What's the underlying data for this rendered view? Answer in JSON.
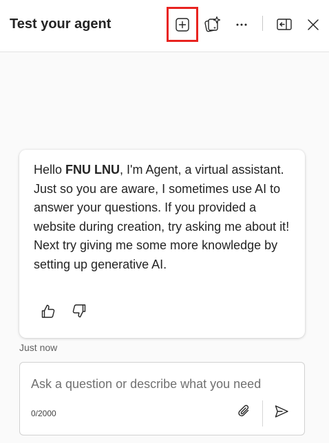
{
  "header": {
    "title": "Test your agent",
    "icons": {
      "new_chat": "add-square-icon",
      "copilot": "sparkle-copy-icon",
      "more": "more-horizontal-icon",
      "dock": "panel-left-icon",
      "close": "close-icon"
    },
    "highlight_color": "#e8231f"
  },
  "message": {
    "greeting": "Hello ",
    "user_name": "FNU LNU",
    "body": ", I'm Agent, a virtual assistant. Just so you are aware, I sometimes use AI to answer your questions. If you provided a website during creation, try asking me about it! Next try giving me some more knowledge by setting up generative AI.",
    "timestamp": "Just now",
    "feedback": {
      "like_icon": "thumbs-up-icon",
      "dislike_icon": "thumbs-down-icon"
    }
  },
  "composer": {
    "placeholder": "Ask a question or describe what you need",
    "value": "",
    "counter": "0/2000",
    "attach_icon": "paperclip-icon",
    "send_icon": "send-icon"
  }
}
